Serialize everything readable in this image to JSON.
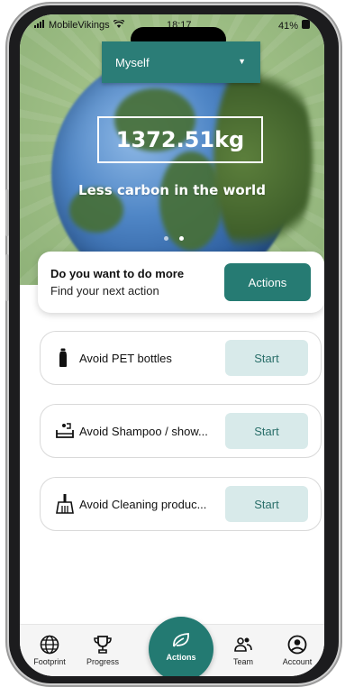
{
  "status_bar": {
    "carrier": "MobileVikings",
    "time": "18:17",
    "battery": "41%"
  },
  "selector": {
    "value": "Myself"
  },
  "hero": {
    "value": "1372.51kg",
    "tagline": "Less carbon in the world"
  },
  "more_card": {
    "title": "Do you want to do more",
    "subtitle": "Find your next action",
    "button": "Actions"
  },
  "actions": [
    {
      "icon": "bottle-icon",
      "title": "Avoid PET bottles",
      "button": "Start"
    },
    {
      "icon": "shampoo-icon",
      "title": "Avoid Shampoo / show...",
      "button": "Start"
    },
    {
      "icon": "broom-icon",
      "title": "Avoid Cleaning produc...",
      "button": "Start"
    }
  ],
  "tabs": {
    "footprint": "Footprint",
    "progress": "Progress",
    "actions": "Actions",
    "team": "Team",
    "account": "Account"
  },
  "colors": {
    "primary": "#267b73",
    "start_button_bg": "#d8eaea"
  }
}
